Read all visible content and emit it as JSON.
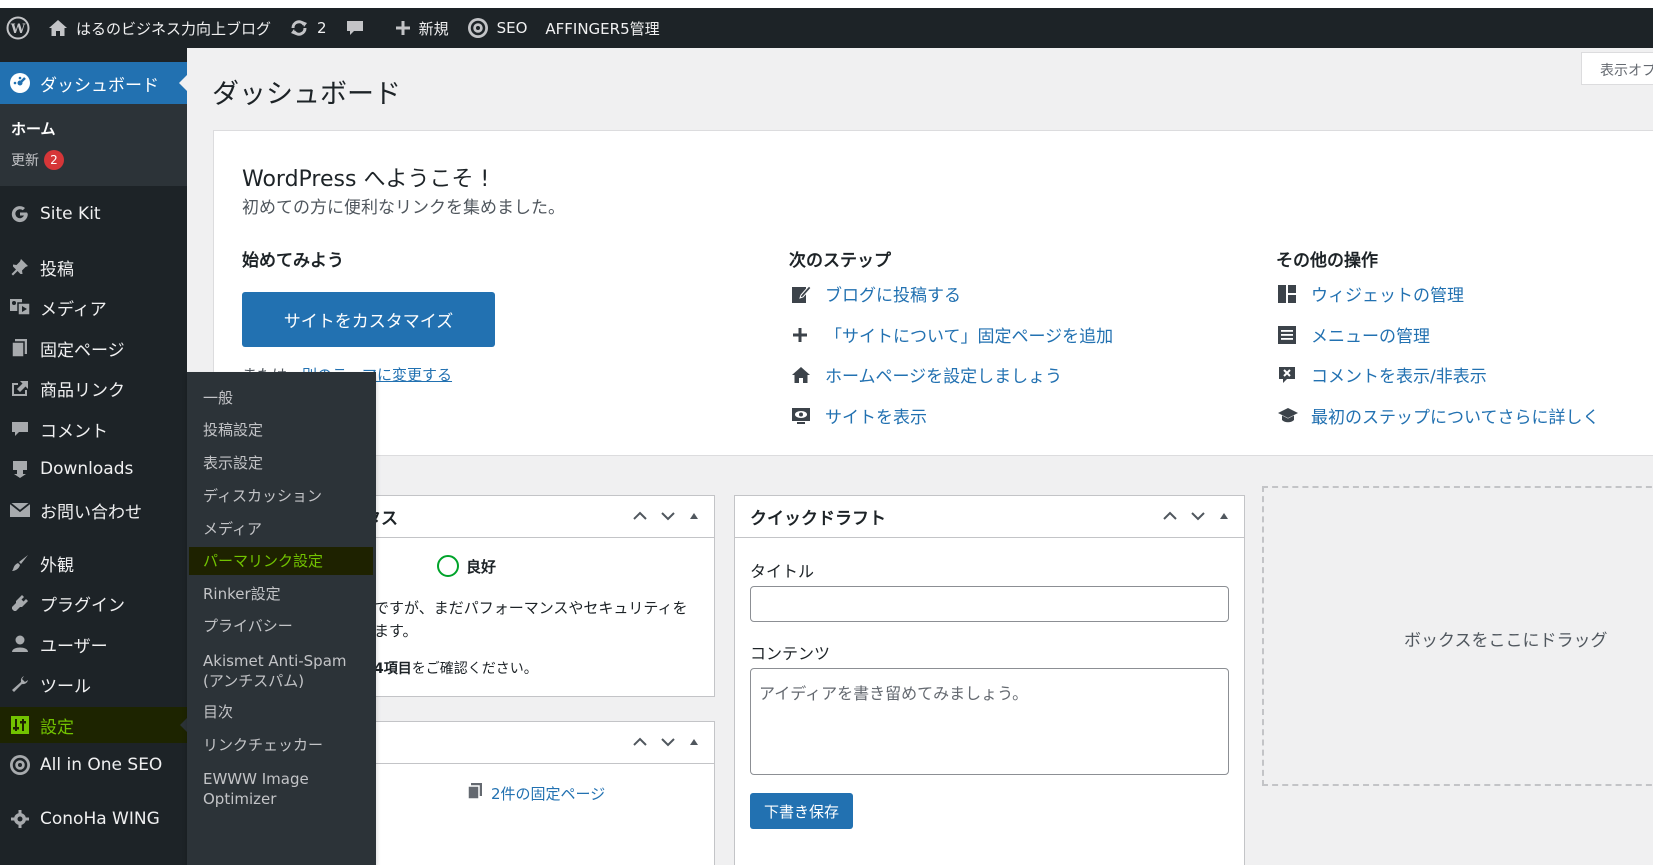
{
  "adminbar": {
    "site_name": "はるのビジネス力向上ブログ",
    "updates_count": "2",
    "new_label": "新規",
    "seo_label": "SEO",
    "affinger_label": "AFFINGER5管理"
  },
  "sidebar": {
    "dashboard": "ダッシュボード",
    "home": "ホーム",
    "updates": "更新",
    "updates_badge": "2",
    "items": [
      {
        "label": "Site Kit",
        "icon": "google-g-icon"
      },
      {
        "label": "投稿",
        "icon": "pin-icon"
      },
      {
        "label": "メディア",
        "icon": "media-icon"
      },
      {
        "label": "固定ページ",
        "icon": "page-icon"
      },
      {
        "label": "商品リンク",
        "icon": "share-icon"
      },
      {
        "label": "コメント",
        "icon": "comment-icon"
      },
      {
        "label": "Downloads",
        "icon": "download-icon"
      },
      {
        "label": "お問い合わせ",
        "icon": "mail-icon"
      },
      {
        "label": "外観",
        "icon": "brush-icon"
      },
      {
        "label": "プラグイン",
        "icon": "plug-icon"
      },
      {
        "label": "ユーザー",
        "icon": "user-icon"
      },
      {
        "label": "ツール",
        "icon": "wrench-icon"
      },
      {
        "label": "設定",
        "icon": "settings-icon"
      },
      {
        "label": "All in One SEO",
        "icon": "aioseo-icon"
      },
      {
        "label": "ConoHa WING",
        "icon": "gear-icon"
      }
    ]
  },
  "flyout": {
    "items": [
      "一般",
      "投稿設定",
      "表示設定",
      "ディスカッション",
      "メディア",
      "パーマリンク設定",
      "Rinker設定",
      "プライバシー",
      "Akismet Anti-Spam",
      "(アンチスパム)",
      "目次",
      "リンクチェッカー",
      "EWWW Image",
      "Optimizer"
    ]
  },
  "main": {
    "title": "ダッシュボード",
    "screen_options": "表示オプション",
    "welcome": {
      "heading": "WordPress へようこそ !",
      "subheading": "初めての方に便利なリンクを集めました。",
      "col1_title": "始めてみよう",
      "customize_button": "サイトをカスタマイズ",
      "alt_prefix": "または、",
      "alt_link": "別のテーマに変更する",
      "col2_title": "次のステップ",
      "col2_links": [
        "ブログに投稿する",
        "「サイトについて」固定ページを追加",
        "ホームページを設定しましょう",
        "サイトを表示"
      ],
      "col3_title": "その他の操作",
      "col3_links": [
        "ウィジェットの管理",
        "メニューの管理",
        "コメントを表示/非表示",
        "最初のステップについてさらに詳しく"
      ]
    },
    "site_health": {
      "title_fragment": "タス",
      "status": "良好",
      "text1": "ですが、まだパフォーマンスやセキュリティを",
      "text2": "ます。",
      "text3_bold": "4項目",
      "text3": "をご確認ください。"
    },
    "at_a_glance": {
      "pages_link": "2件の固定ページ"
    },
    "quick_draft": {
      "title": "クイックドラフト",
      "title_label": "タイトル",
      "content_label": "コンテンツ",
      "content_placeholder": "アイディアを書き留めてみましょう。",
      "save_button": "下書き保存"
    },
    "dropzone_text": "ボックスをここにドラッグ"
  }
}
